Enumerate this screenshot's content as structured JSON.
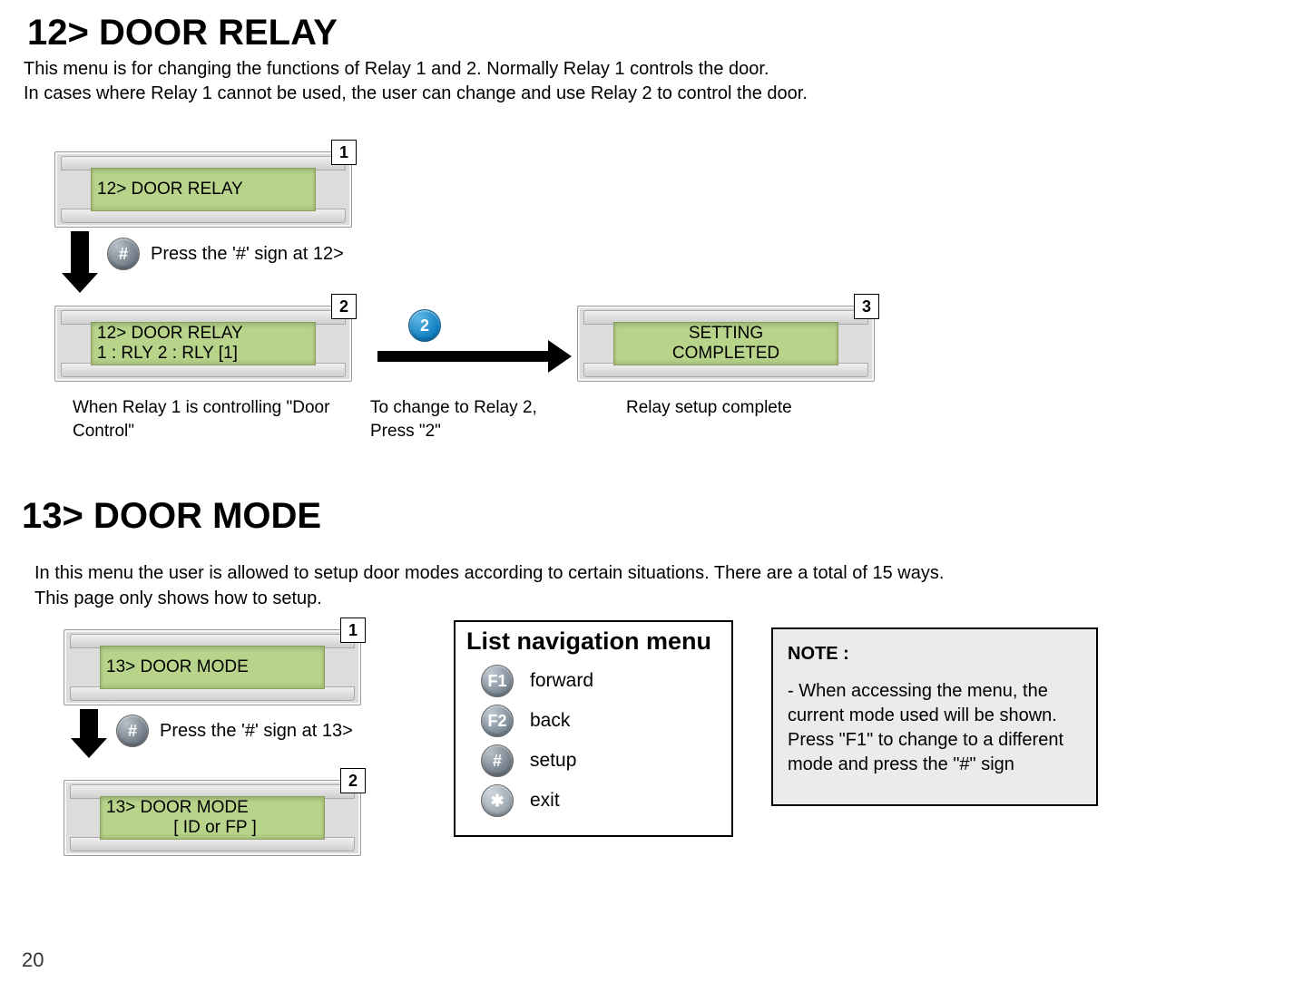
{
  "page_number": "20",
  "section_a": {
    "heading": "12> DOOR RELAY",
    "intro_line1": "This menu is for changing the functions of Relay 1 and 2. Normally Relay 1 controls the door.",
    "intro_line2": "In cases where Relay 1 cannot be used, the user can change and use Relay 2 to control the door.",
    "lcd1": {
      "num": "1",
      "line1": "12> DOOR RELAY"
    },
    "press_label": "Press the '#' sign at 12>",
    "lcd2": {
      "num": "2",
      "line1": "12> DOOR RELAY",
      "line2": "1 : RLY 2 : RLY [1]"
    },
    "key2_label": "2",
    "lcd3": {
      "num": "3",
      "line1": "SETTING",
      "line2": "COMPLETED"
    },
    "caption1": "When Relay 1 is controlling \"Door Control\"",
    "caption2": "To change to Relay 2, Press \"2\"",
    "caption3": "Relay setup complete"
  },
  "section_b": {
    "heading": "13> DOOR MODE",
    "desc_line1": "In this menu the user is allowed to setup door modes according to certain situations. There are a total of 15 ways.",
    "desc_line2": "This page only shows how to setup.",
    "lcd1": {
      "num": "1",
      "line1": "13> DOOR MODE"
    },
    "press_label": "Press the '#' sign at 13>",
    "lcd2": {
      "num": "2",
      "line1": "13> DOOR MODE",
      "line2": "[ ID or FP ]"
    },
    "navbox": {
      "title": "List navigation menu",
      "items": [
        {
          "key": "F1",
          "label": "forward"
        },
        {
          "key": "F2",
          "label": "back"
        },
        {
          "key": "#",
          "label": "setup"
        },
        {
          "key": "✱",
          "label": "exit"
        }
      ]
    },
    "note": {
      "title": "NOTE :",
      "body": "- When accessing the menu, the current mode used will be shown. Press \"F1\" to change to a different mode and press the \"#\" sign"
    }
  }
}
